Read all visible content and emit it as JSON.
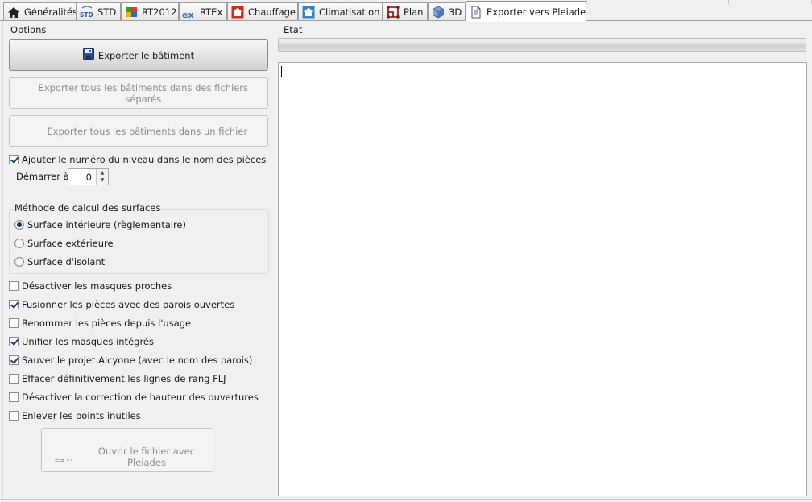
{
  "tabs": [
    {
      "label": "Généralités",
      "icon": "home-icon"
    },
    {
      "label": "STD",
      "icon": "std-icon"
    },
    {
      "label": "RT2012",
      "icon": "rt2012-icon"
    },
    {
      "label": "RTEx",
      "icon": "rtex-icon"
    },
    {
      "label": "Chauffage",
      "icon": "heating-house-icon"
    },
    {
      "label": "Climatisation",
      "icon": "cooling-house-icon"
    },
    {
      "label": "Plan",
      "icon": "plan-icon"
    },
    {
      "label": "3D",
      "icon": "cube-3d-icon"
    },
    {
      "label": "Exporter vers Pleiades",
      "icon": "export-document-icon",
      "active": true
    }
  ],
  "std_icon_text": "STD",
  "rtex_icon_text": "ex",
  "options": {
    "title": "Options",
    "export_building_label": "Exporter le bâtiment",
    "export_all_separate_label": "Exporter tous les bâtiments dans des fichiers séparés",
    "export_all_single_label": "Exporter tous les bâtiments dans un fichier",
    "add_level_number": {
      "label": "Ajouter le numéro du niveau dans le nom des pièces",
      "checked": true
    },
    "start_at": {
      "label": "Démarrer à",
      "value": "0"
    },
    "surface_method": {
      "title": "Méthode de calcul des surfaces",
      "options": [
        {
          "label": "Surface intérieure (règlementaire)",
          "selected": true
        },
        {
          "label": "Surface extérieure",
          "selected": false
        },
        {
          "label": "Surface d'isolant",
          "selected": false
        }
      ]
    },
    "checkboxes": [
      {
        "label": "Désactiver les masques proches",
        "checked": false
      },
      {
        "label": "Fusionner les pièces avec des parois ouvertes",
        "checked": true
      },
      {
        "label": "Renommer les pièces depuis l'usage",
        "checked": false
      },
      {
        "label": "Unifier les masques intégrés",
        "checked": true
      },
      {
        "label": "Sauver le projet Alcyone (avec le nom des parois)",
        "checked": true
      },
      {
        "label": "Effacer définitivement les lignes de rang FLJ",
        "checked": false
      },
      {
        "label": "Désactiver la correction de hauteur des ouvertures",
        "checked": false
      },
      {
        "label": "Enlever les points inutiles",
        "checked": false
      }
    ],
    "open_pleiades_label": "Ouvrir le fichier avec Pleiades"
  },
  "status": {
    "label": "Etat",
    "progress": 0,
    "log_text": ""
  }
}
